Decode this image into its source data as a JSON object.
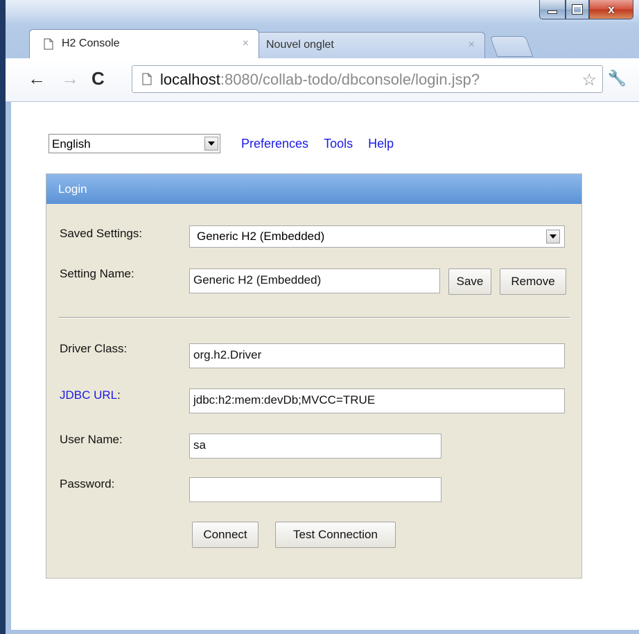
{
  "tabs": [
    {
      "title": "H2 Console",
      "close": "×",
      "icon": "page-icon"
    },
    {
      "title": "Nouvel onglet",
      "close": "×"
    }
  ],
  "window_controls": {
    "close": "x"
  },
  "toolbar": {
    "back": "←",
    "forward": "→",
    "reload": "C",
    "url_host": "localhost",
    "url_rest": ":8080/collab-todo/dbconsole/login.jsp?",
    "star": "☆",
    "wrench": "🔧"
  },
  "top": {
    "language": "English",
    "links": [
      "Preferences",
      "Tools",
      "Help"
    ]
  },
  "login": {
    "header": "Login",
    "saved_settings_label": "Saved Settings:",
    "saved_settings_value": "Generic H2 (Embedded)",
    "setting_name_label": "Setting Name:",
    "setting_name_value": "Generic H2 (Embedded)",
    "save_label": "Save",
    "remove_label": "Remove",
    "driver_class_label": "Driver Class:",
    "driver_class_value": "org.h2.Driver",
    "jdbc_url_label": "JDBC URL",
    "jdbc_url_colon": ":",
    "jdbc_url_value": "jdbc:h2:mem:devDb;MVCC=TRUE",
    "user_name_label": "User Name:",
    "user_name_value": "sa",
    "password_label": "Password:",
    "password_value": "",
    "connect_label": "Connect",
    "test_connection_label": "Test Connection"
  },
  "colors": {
    "link": "#1a1ae6",
    "panel_bg": "#ebe7d8",
    "header_bg": "#5a93d6"
  }
}
